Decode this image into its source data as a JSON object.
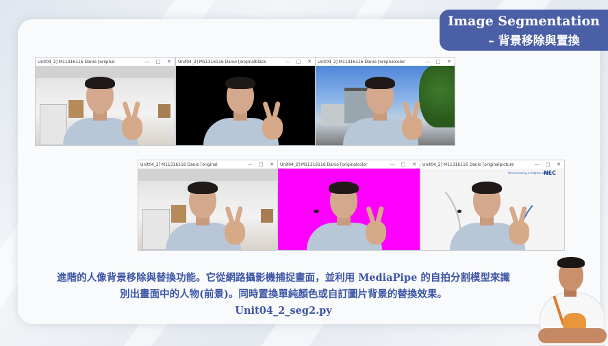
{
  "slide": {
    "title_line1": "Image Segmentation",
    "title_line2": "– 背景移除與置換",
    "accent_color": "#4b5fa6",
    "caption_line1": "進階的人像背景移除與替換功能。它從網路攝影機捕捉畫面，並利用 MediaPipe 的自拍分割模型來識",
    "caption_line2": "別出畫面中的人物(前景)。同時置換單純顏色或自訂圖片背景的替換效果。",
    "caption_line3": "Unit04_2_seg2.py"
  },
  "windows_row1": [
    {
      "title": "Unit04_2] M11316116 Danio [original",
      "background": "office"
    },
    {
      "title": "Unit04_2] M11316116 Danio [originalblack",
      "background": "black"
    },
    {
      "title": "Unit04_2] M11316116 Danio [originalcolor",
      "background": "city"
    }
  ],
  "windows_row2": [
    {
      "title": "Unit04_2] M11316116 Danio [original",
      "background": "office"
    },
    {
      "title": "Unit04_2] M11316116 Danio [originalcolor",
      "background": "magenta"
    },
    {
      "title": "Unit04_2] M11316116 Danio [originalpicture",
      "background": "picture"
    }
  ],
  "window_controls": {
    "minimize": "—",
    "maximize": "□",
    "close": "✕"
  },
  "picture_bg": {
    "tagline": "Orchestrating a brighter world",
    "logo": "NEC"
  },
  "colors": {
    "caption": "#3d55a6",
    "magenta_bg": "#ff00ff"
  }
}
